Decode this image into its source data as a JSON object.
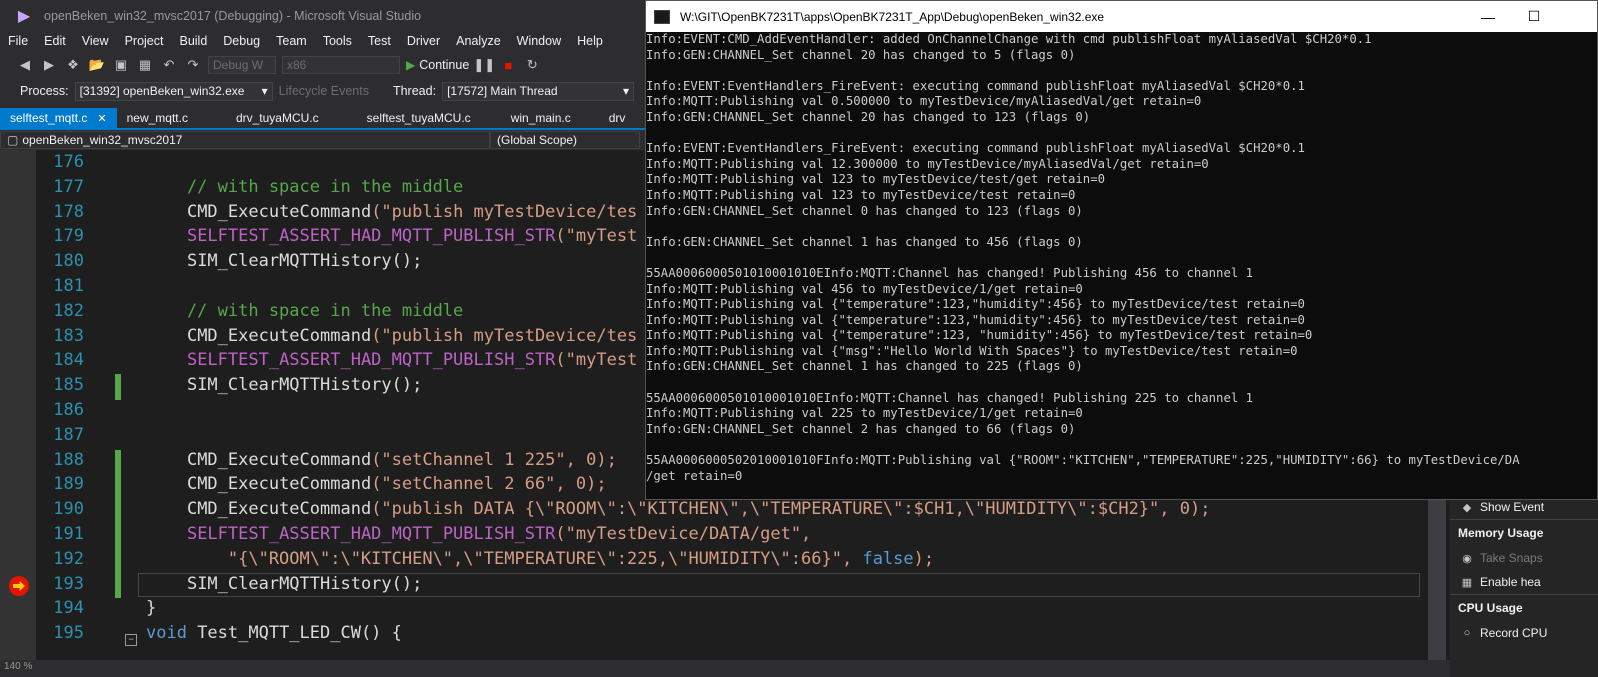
{
  "window": {
    "title": "openBeken_win32_mvsc2017 (Debugging) - Microsoft Visual Studio"
  },
  "menu": [
    "File",
    "Edit",
    "View",
    "Project",
    "Build",
    "Debug",
    "Team",
    "Tools",
    "Test",
    "Driver",
    "Analyze",
    "Window",
    "Help"
  ],
  "toolbar": {
    "config": "Debug W",
    "platform": "x86",
    "continue_label": "Continue"
  },
  "toolbar2": {
    "process_label": "Process:",
    "process_value": "[31392] openBeken_win32.exe",
    "lifecycle_label": "Lifecycle Events",
    "thread_label": "Thread:",
    "thread_value": "[17572] Main Thread"
  },
  "tabs": [
    "selftest_mqtt.c",
    "new_mqtt.c",
    "drv_tuyaMCU.c",
    "selftest_tuyaMCU.c",
    "win_main.c",
    "drv"
  ],
  "navbar": {
    "project": "openBeken_win32_mvsc2017",
    "scope": "(Global Scope)"
  },
  "code_lines": [
    {
      "n": "176",
      "t": ""
    },
    {
      "n": "177",
      "t": "    // with space in the middle"
    },
    {
      "n": "178",
      "t": "    CMD_ExecuteCommand(\"publish myTestDevice/tes"
    },
    {
      "n": "179",
      "t": "    SELFTEST_ASSERT_HAD_MQTT_PUBLISH_STR(\"myTest"
    },
    {
      "n": "180",
      "t": "    SIM_ClearMQTTHistory();"
    },
    {
      "n": "181",
      "t": ""
    },
    {
      "n": "182",
      "t": "    // with space in the middle"
    },
    {
      "n": "183",
      "t": "    CMD_ExecuteCommand(\"publish myTestDevice/tes"
    },
    {
      "n": "184",
      "t": "    SELFTEST_ASSERT_HAD_MQTT_PUBLISH_STR(\"myTest"
    },
    {
      "n": "185",
      "t": "    SIM_ClearMQTTHistory();"
    },
    {
      "n": "186",
      "t": ""
    },
    {
      "n": "187",
      "t": ""
    },
    {
      "n": "188",
      "t": "    CMD_ExecuteCommand(\"setChannel 1 225\", 0);"
    },
    {
      "n": "189",
      "t": "    CMD_ExecuteCommand(\"setChannel 2 66\", 0);"
    },
    {
      "n": "190",
      "t": "    CMD_ExecuteCommand(\"publish DATA {\\\"ROOM\\\":\\\"KITCHEN\\\",\\\"TEMPERATURE\\\":$CH1,\\\"HUMIDITY\\\":$CH2}\", 0);"
    },
    {
      "n": "191",
      "t": "    SELFTEST_ASSERT_HAD_MQTT_PUBLISH_STR(\"myTestDevice/DATA/get\","
    },
    {
      "n": "192",
      "t": "        \"{\\\"ROOM\\\":\\\"KITCHEN\\\",\\\"TEMPERATURE\\\":225,\\\"HUMIDITY\\\":66}\", false);"
    },
    {
      "n": "193",
      "t": "    SIM_ClearMQTTHistory();"
    },
    {
      "n": "194",
      "t": "}"
    },
    {
      "n": "195",
      "t": "void Test_MQTT_LED_CW() {"
    }
  ],
  "zoom": "140 %",
  "diagnostics": {
    "show_events": "Show Event",
    "memory_header": "Memory Usage",
    "take_snapshot": "Take Snaps",
    "enable_heap": "Enable hea",
    "cpu_header": "CPU Usage",
    "record_cpu": "Record CPU"
  },
  "console": {
    "title": "W:\\GIT\\OpenBK7231T\\apps\\OpenBK7231T_App\\Debug\\openBeken_win32.exe",
    "lines": [
      "Info:EVENT:CMD_AddEventHandler: added OnChannelChange with cmd publishFloat myAliasedVal $CH20*0.1",
      "Info:GEN:CHANNEL_Set channel 20 has changed to 5 (flags 0)",
      "",
      "Info:EVENT:EventHandlers_FireEvent: executing command publishFloat myAliasedVal $CH20*0.1",
      "Info:MQTT:Publishing val 0.500000 to myTestDevice/myAliasedVal/get retain=0",
      "Info:GEN:CHANNEL_Set channel 20 has changed to 123 (flags 0)",
      "",
      "Info:EVENT:EventHandlers_FireEvent: executing command publishFloat myAliasedVal $CH20*0.1",
      "Info:MQTT:Publishing val 12.300000 to myTestDevice/myAliasedVal/get retain=0",
      "Info:MQTT:Publishing val 123 to myTestDevice/test/get retain=0",
      "Info:MQTT:Publishing val 123 to myTestDevice/test retain=0",
      "Info:GEN:CHANNEL_Set channel 0 has changed to 123 (flags 0)",
      "",
      "Info:GEN:CHANNEL_Set channel 1 has changed to 456 (flags 0)",
      "",
      "55AA0006000501010001010EInfo:MQTT:Channel has changed! Publishing 456 to channel 1",
      "Info:MQTT:Publishing val 456 to myTestDevice/1/get retain=0",
      "Info:MQTT:Publishing val {\"temperature\":123,\"humidity\":456} to myTestDevice/test retain=0",
      "Info:MQTT:Publishing val {\"temperature\":123,\"humidity\":456} to myTestDevice/test retain=0",
      "Info:MQTT:Publishing val {\"temperature\":123, \"humidity\":456} to myTestDevice/test retain=0",
      "Info:MQTT:Publishing val {\"msg\":\"Hello World With Spaces\"} to myTestDevice/test retain=0",
      "Info:GEN:CHANNEL_Set channel 1 has changed to 225 (flags 0)",
      "",
      "55AA0006000501010001010EInfo:MQTT:Channel has changed! Publishing 225 to channel 1",
      "Info:MQTT:Publishing val 225 to myTestDevice/1/get retain=0",
      "Info:GEN:CHANNEL_Set channel 2 has changed to 66 (flags 0)",
      "",
      "55AA0006000502010001010FInfo:MQTT:Publishing val {\"ROOM\":\"KITCHEN\",\"TEMPERATURE\":225,\"HUMIDITY\":66} to myTestDevice/DA",
      "/get retain=0"
    ]
  }
}
